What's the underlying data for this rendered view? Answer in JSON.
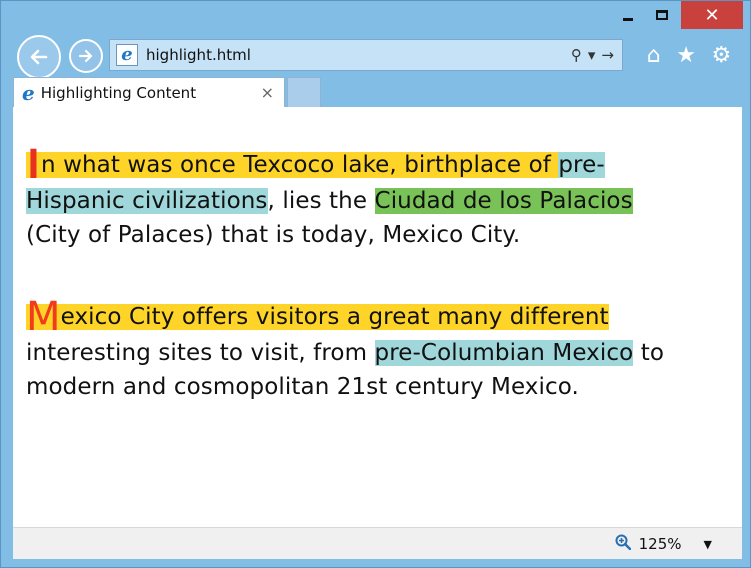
{
  "window": {
    "minimize_symbol": "",
    "close_symbol": "✕"
  },
  "address_bar": {
    "url": "highlight.html",
    "search_symbol": "⚲",
    "dropdown_symbol": "▾",
    "go_symbol": "→"
  },
  "toolbar": {
    "home_symbol": "⌂",
    "favorites_symbol": "★",
    "settings_symbol": "⚙"
  },
  "tab": {
    "title": "Highlighting Content",
    "close_symbol": "×"
  },
  "content": {
    "p1": {
      "dropcap": "I",
      "l1_a": "n what was once Texcoco lake, birthplace of ",
      "l1_b": "pre-",
      "l2_a": "Hispanic civilizations",
      "l2_b": ", lies the ",
      "l2_c": "Ciudad de los Palacios",
      "l3": "(City of Palaces) that is today, Mexico City."
    },
    "p2": {
      "dropcap": "M",
      "l1": "exico City offers visitors a great many different",
      "l2_a": "interesting sites to visit, from ",
      "l2_b": "pre-Columbian Mexico",
      "l2_c": " to",
      "l3": "modern and cosmopolitan 21st century Mexico."
    }
  },
  "status": {
    "zoom": "125%",
    "zoom_caret": "▼"
  },
  "colors": {
    "highlight_yellow": "#ffd428",
    "highlight_teal": "#9fd7da",
    "highlight_green": "#79c257",
    "dropcap_red": "#e8311f"
  }
}
